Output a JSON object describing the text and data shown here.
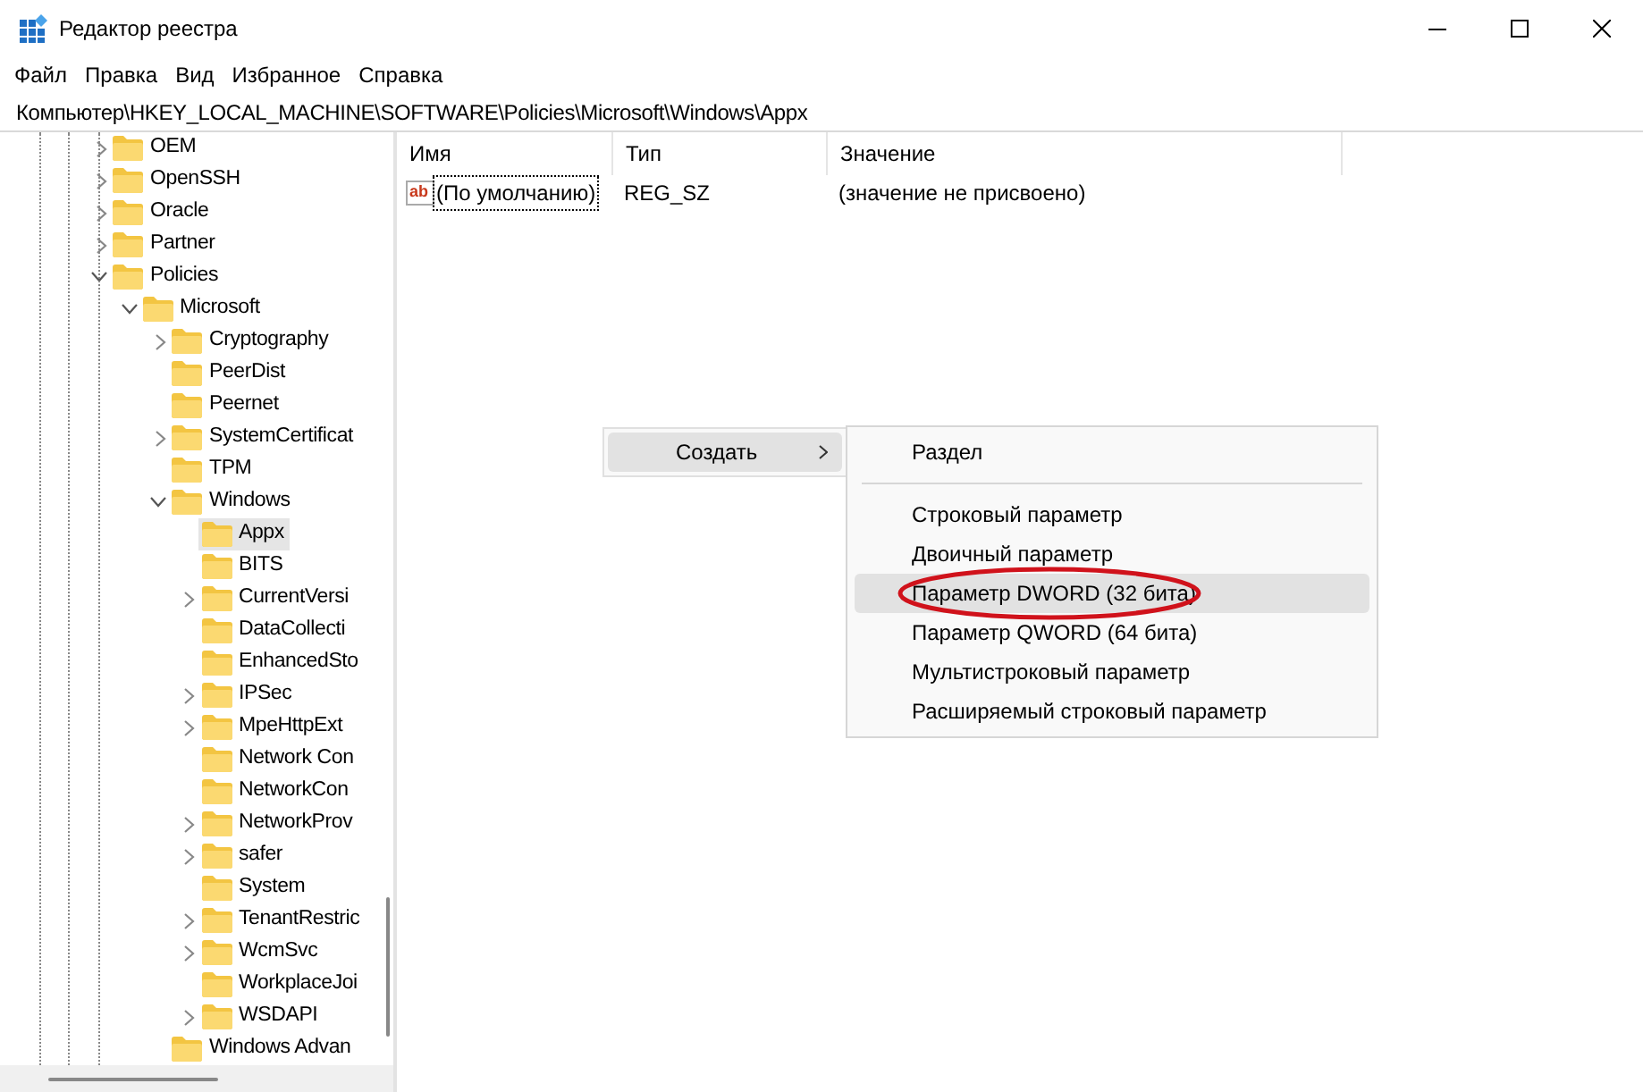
{
  "window": {
    "title": "Редактор реестра"
  },
  "menu": [
    "Файл",
    "Правка",
    "Вид",
    "Избранное",
    "Справка"
  ],
  "address": "Компьютер\\HKEY_LOCAL_MACHINE\\SOFTWARE\\Policies\\Microsoft\\Windows\\Appx",
  "tree": [
    {
      "label": "OEM",
      "expanded": false,
      "selected": false
    },
    {
      "label": "OpenSSH",
      "expanded": false,
      "selected": false
    },
    {
      "label": "Oracle",
      "expanded": false,
      "selected": false
    },
    {
      "label": "Partner",
      "expanded": false,
      "selected": false
    },
    {
      "label": "Policies",
      "expanded": true,
      "selected": false,
      "children": [
        {
          "label": "Microsoft",
          "expanded": true,
          "selected": false,
          "children": [
            {
              "label": "Cryptography",
              "expanded": false,
              "selected": false
            },
            {
              "label": "PeerDist",
              "selected": false
            },
            {
              "label": "Peernet",
              "selected": false
            },
            {
              "label": "SystemCertificat",
              "expanded": false,
              "selected": false
            },
            {
              "label": "TPM",
              "selected": false
            },
            {
              "label": "Windows",
              "expanded": true,
              "selected": false,
              "children": [
                {
                  "label": "Appx",
                  "selected": true
                },
                {
                  "label": "BITS",
                  "selected": false
                },
                {
                  "label": "CurrentVersi",
                  "expanded": false,
                  "selected": false
                },
                {
                  "label": "DataCollecti",
                  "selected": false
                },
                {
                  "label": "EnhancedSto",
                  "selected": false
                },
                {
                  "label": "IPSec",
                  "expanded": false,
                  "selected": false
                },
                {
                  "label": "MpeHttpExt",
                  "expanded": false,
                  "selected": false
                },
                {
                  "label": "Network Con",
                  "selected": false
                },
                {
                  "label": "NetworkCon",
                  "selected": false
                },
                {
                  "label": "NetworkProv",
                  "expanded": false,
                  "selected": false
                },
                {
                  "label": "safer",
                  "expanded": false,
                  "selected": false
                },
                {
                  "label": "System",
                  "selected": false
                },
                {
                  "label": "TenantRestric",
                  "expanded": false,
                  "selected": false
                },
                {
                  "label": "WcmSvc",
                  "expanded": false,
                  "selected": false
                },
                {
                  "label": "WorkplaceJoi",
                  "selected": false
                },
                {
                  "label": "WSDAPI",
                  "expanded": false,
                  "selected": false
                }
              ]
            },
            {
              "label": "Windows Advan",
              "selected": false
            }
          ]
        }
      ]
    }
  ],
  "table": {
    "columns": [
      "Имя",
      "Тип",
      "Значение"
    ],
    "rows": [
      {
        "icon": "ab",
        "name": "(По умолчанию)",
        "type": "REG_SZ",
        "value": "(значение не присвоено)",
        "focused": true
      }
    ]
  },
  "context_menu": {
    "items": [
      {
        "label": "Создать",
        "submenu": true,
        "selected": true
      }
    ]
  },
  "submenu": {
    "items": [
      {
        "kind": "item",
        "label": "Раздел",
        "selected": false,
        "circled": false
      },
      {
        "kind": "separator"
      },
      {
        "kind": "item",
        "label": "Строковый параметр",
        "selected": false,
        "circled": false
      },
      {
        "kind": "item",
        "label": "Двоичный параметр",
        "selected": false,
        "circled": false
      },
      {
        "kind": "item",
        "label": "Параметр DWORD (32 бита)",
        "selected": true,
        "circled": true
      },
      {
        "kind": "item",
        "label": "Параметр QWORD (64 бита)",
        "selected": false,
        "circled": false
      },
      {
        "kind": "item",
        "label": "Мультистроковый параметр",
        "selected": false,
        "circled": false
      },
      {
        "kind": "item",
        "label": "Расширяемый строковый параметр",
        "selected": false,
        "circled": false
      }
    ]
  }
}
